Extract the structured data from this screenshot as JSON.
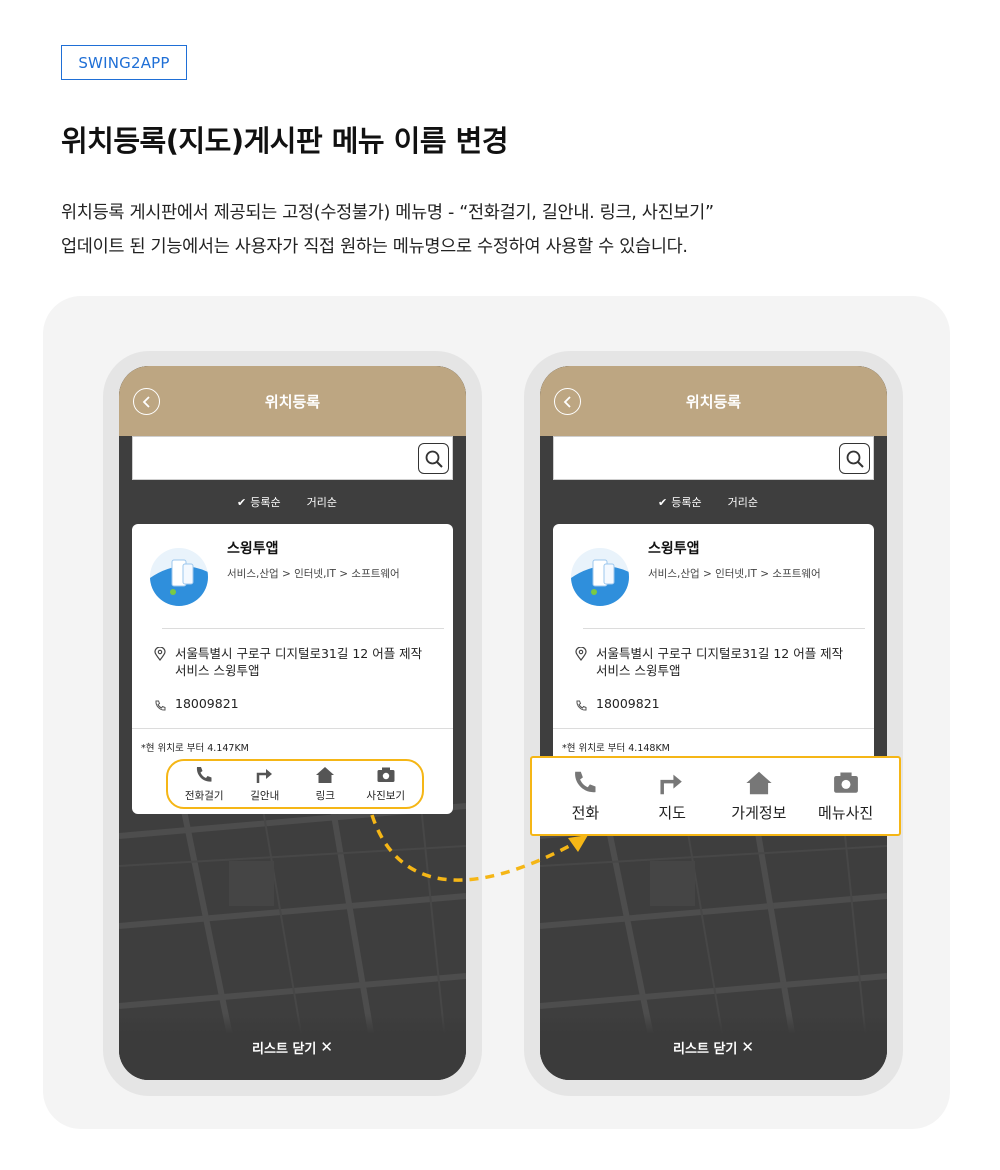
{
  "tag": "SWING2APP",
  "title": "위치등록(지도)게시판 메뉴 이름 변경",
  "description": {
    "line1": "위치등록 게시판에서 제공되는 고정(수정불가) 메뉴명 - “전화걸기, 길안내. 링크, 사진보기”",
    "line2": "업데이트 된 기능에서는 사용자가 직접 원하는 메뉴명으로 수정하여 사용할 수 있습니다."
  },
  "phoneA": {
    "header_title": "위치등록",
    "sort": [
      "등록순",
      "거리순"
    ],
    "store_name": "스윙투앱",
    "store_category": "서비스,산업 > 인터넷,IT > 소프트웨어",
    "address": "서울특별시 구로구 디지털로31길 12 어플 제작 서비스 스윙투앱",
    "phone": "18009821",
    "distance": "*현 위치로 부터 4.147KM",
    "actions": [
      "전화걸기",
      "길안내",
      "링크",
      "사진보기"
    ],
    "close_label": "리스트 닫기"
  },
  "phoneB": {
    "header_title": "위치등록",
    "sort": [
      "등록순",
      "거리순"
    ],
    "store_name": "스윙투앱",
    "store_category": "서비스,산업 > 인터넷,IT > 소프트웨어",
    "address": "서울특별시 구로구 디지털로31길 12 어플 제작 서비스 스윙투앱",
    "phone": "18009821",
    "distance": "*현 위치로 부터 4.148KM",
    "actions": [
      "전화",
      "지도",
      "가게정보",
      "메뉴사진"
    ],
    "close_label": "리스트 닫기"
  },
  "icons": [
    "phone-icon",
    "turn-arrow-icon",
    "home-icon",
    "camera-icon",
    "back-icon",
    "search-icon",
    "pin-icon",
    "check-icon",
    "close-icon"
  ],
  "colors": {
    "accent": "#1f6fd6",
    "header": "#bda682",
    "highlight": "#f5b616",
    "map": "#3c3c3c"
  }
}
